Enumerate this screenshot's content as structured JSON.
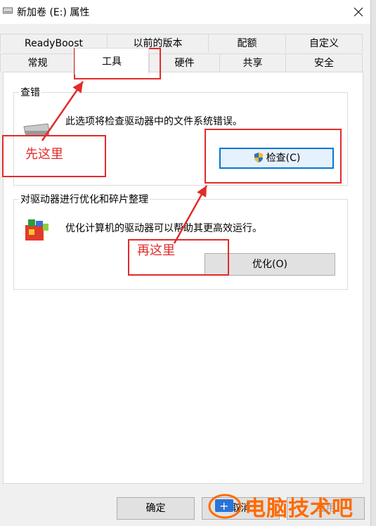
{
  "window": {
    "title": "新加卷 (E:) 属性"
  },
  "tabs": {
    "row1": [
      "ReadyBoost",
      "以前的版本",
      "配额",
      "自定义"
    ],
    "row2": [
      "常规",
      "工具",
      "硬件",
      "共享",
      "安全"
    ],
    "active": "工具"
  },
  "error_check": {
    "group_title": "查错",
    "description": "此选项将检查驱动器中的文件系统错误。",
    "button_label": "检查(C)"
  },
  "optimize": {
    "group_title": "对驱动器进行优化和碎片整理",
    "description": "优化计算机的驱动器可以帮助其更高效运行。",
    "button_label": "优化(O)"
  },
  "annotations": {
    "first": "先这里",
    "second": "再这里",
    "color": "#e32a2a"
  },
  "footer": {
    "ok_label": "确定",
    "cancel_label": "取消",
    "apply_label": "应用"
  },
  "watermark": {
    "text": "电脑技术吧",
    "color": "#ff6a00"
  }
}
